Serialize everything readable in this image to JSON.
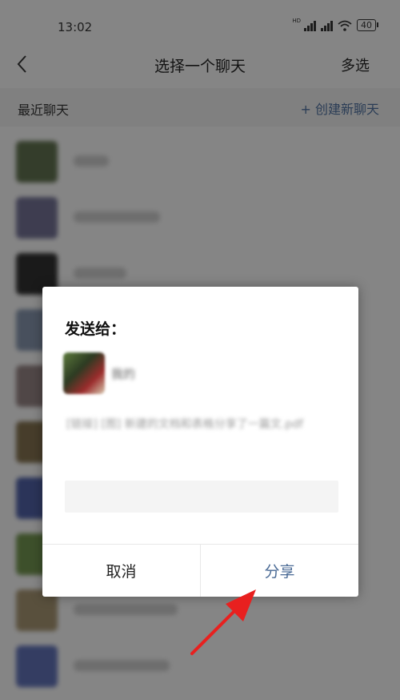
{
  "status_bar": {
    "time": "13:02",
    "hd_label": "HD",
    "battery": "40"
  },
  "nav": {
    "title": "选择一个聊天",
    "multi_select_label": "多选"
  },
  "section": {
    "recent_label": "最近聊天",
    "new_chat_label": "+ 创建新聊天"
  },
  "chat_list": {
    "count": 10
  },
  "dialog": {
    "title": "发送给：",
    "recipient_name": "我的",
    "share_text": "[链接] [图] 新建的文档和表格分享了一篇文.pdf",
    "message_placeholder": "",
    "cancel_label": "取消",
    "share_label": "分享"
  },
  "colors": {
    "accent": "#4a6a95",
    "pointer_arrow": "#e8201f"
  },
  "icons": {
    "back": "chevron-left-icon",
    "pointer": "red-arrow-icon"
  }
}
